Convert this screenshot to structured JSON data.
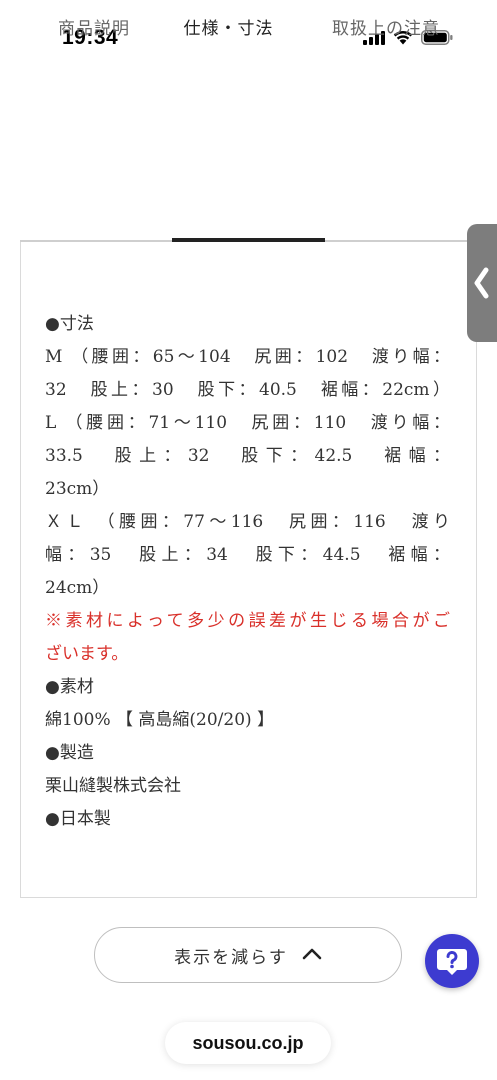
{
  "status_bar": {
    "time": "19:34"
  },
  "tabs": [
    {
      "label": "商品説明",
      "active": false
    },
    {
      "label": "仕様・寸法",
      "active": true
    },
    {
      "label": "取扱上の注意",
      "active": false
    }
  ],
  "spec": {
    "lines": [
      "●寸法",
      "M （腰囲：65～104　尻囲：102　渡り幅：",
      "32　股上：30　股下：40.5　裾幅：22cm）",
      "L （腰囲：71～110　尻囲：110　渡り幅：",
      "33.5　股上：32　股下：42.5　裾幅：",
      "23cm）",
      "ＸＬ （腰囲：77～116　尻囲：116　渡り",
      "幅：35　股上：34　股下：44.5　裾幅：",
      "24cm）"
    ],
    "note_lines": [
      "※素材によって多少の誤差が生じる場合がご",
      "ざいます。"
    ],
    "material_heading": "●素材",
    "material": "綿100% 【 高島縮(20/20) 】",
    "manufacture_heading": "●製造",
    "manufacturer": "栗山縫製株式会社",
    "origin": "●日本製"
  },
  "collapse_button": {
    "label": "表示を減らす"
  },
  "url_bar": {
    "domain": "sousou.co.jp"
  },
  "colors": {
    "accent_red": "#d9302a",
    "help_fab": "#3d3bd0",
    "side_handle": "#7d7d7d"
  },
  "icons": {
    "signal": "cellular-signal-icon",
    "wifi": "wifi-icon",
    "battery": "battery-icon",
    "side_handle": "chevron-left-icon",
    "collapse": "chevron-up-icon",
    "help": "question-mark-icon"
  }
}
